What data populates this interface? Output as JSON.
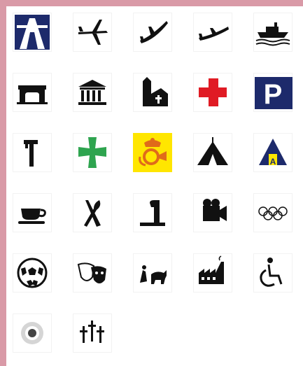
{
  "colors": {
    "background": "#d99aa7",
    "panel": "#ffffff",
    "icon": "#111111",
    "navy": "#1d2a6b",
    "red": "#e01b24",
    "green": "#2ea44f",
    "yellow": "#ffe600",
    "orange": "#e06b1a"
  },
  "symbols": [
    {
      "row": 1,
      "items": [
        "motorway-icon",
        "airport-icon",
        "plane-departure-icon",
        "plane-arrival-icon",
        "ship-ferry-icon"
      ]
    },
    {
      "row": 2,
      "items": [
        "gate-icon",
        "museum-icon",
        "church-icon",
        "first-aid-cross-icon",
        "parking-icon"
      ]
    },
    {
      "row": 3,
      "items": [
        "tool-icon",
        "green-cross-pharmacy-icon",
        "post-horn-icon",
        "tent-camping-icon",
        "tent-with-a-icon"
      ]
    },
    {
      "row": 4,
      "items": [
        "cup-saucer-icon",
        "fork-knife-icon",
        "fountain-icon",
        "camera-projector-icon",
        "olympic-rings-icon"
      ]
    },
    {
      "row": 5,
      "items": [
        "soccer-ball-icon",
        "theatre-masks-icon",
        "bullfight-icon",
        "factory-icon",
        "wheelchair-icon"
      ]
    },
    {
      "row": 6,
      "items": [
        "target-icon",
        "cemetery-crosses-icon"
      ]
    }
  ],
  "labels": {
    "parking_letter": "P",
    "camping_letter": "A"
  }
}
